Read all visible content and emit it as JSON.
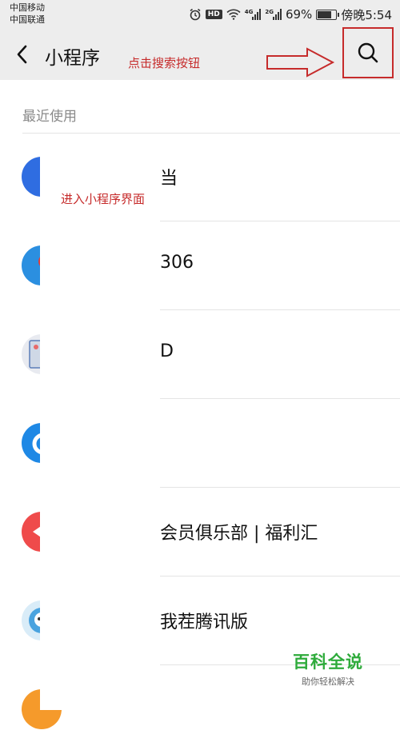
{
  "status_bar": {
    "carrier1": "中国移动",
    "carrier2": "中国联通",
    "hd": "HD",
    "net1": "4G",
    "net2": "2G",
    "battery": "69%",
    "battery_level": 0.69,
    "time": "傍晚5:54"
  },
  "header": {
    "title": "小程序",
    "search_annotation": "点击搜索按钮"
  },
  "section_label": "最近使用",
  "enter_annotation": "进入小程序界面",
  "rows": [
    {
      "label": "当",
      "icon": "blue-logo-icon",
      "color": "#2f6de1"
    },
    {
      "label": "306",
      "icon": "railway-12306-icon",
      "color": "#2b8fe0"
    },
    {
      "label": "D",
      "icon": "app-thumbnail-icon",
      "color": "#e8eaf0"
    },
    {
      "label": "",
      "icon": "blue-ring-icon",
      "color": "#1e88e5"
    },
    {
      "label": "会员俱乐部 | 福利汇",
      "icon": "red-badge-icon",
      "color": "#ef4b4b"
    },
    {
      "label": "我茬腾讯版",
      "icon": "robot-mascot-icon",
      "color": "#4aa3df"
    },
    {
      "label": "",
      "icon": "orange-circle-icon",
      "color": "#f59a2b"
    }
  ],
  "watermark": {
    "title": "百科全说",
    "subtitle": "助你轻松解决"
  }
}
